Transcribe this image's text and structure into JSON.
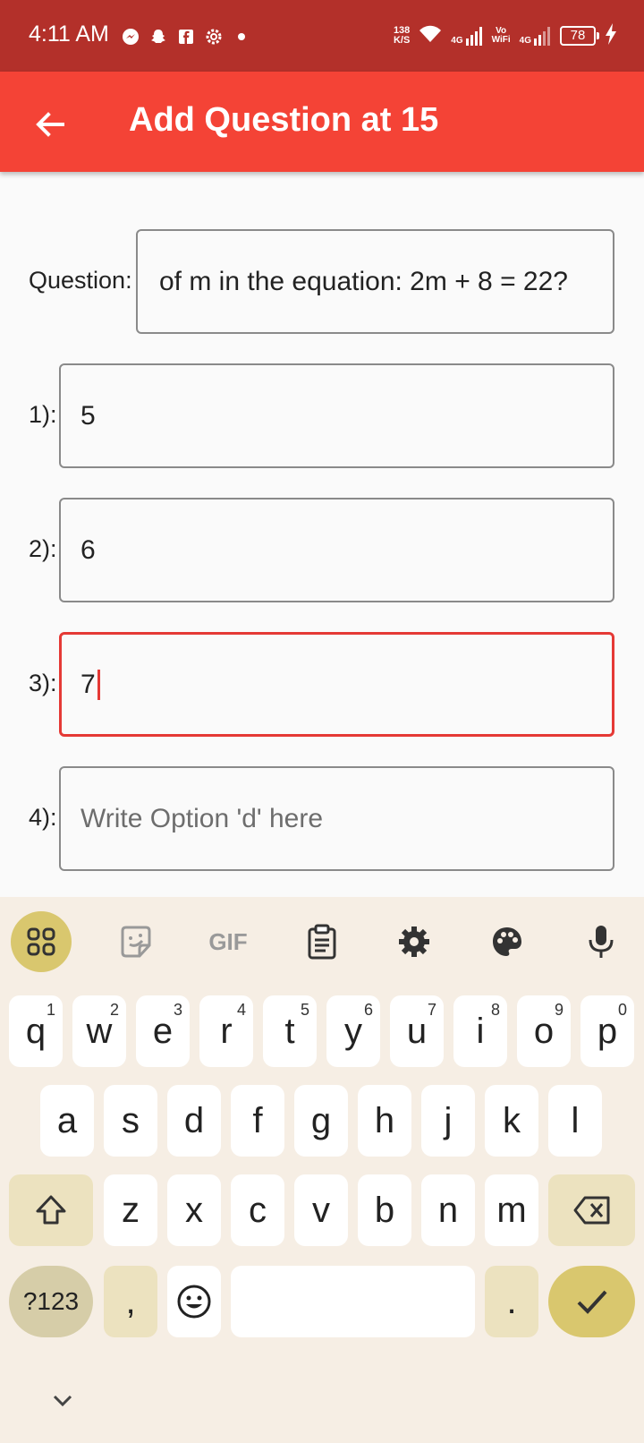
{
  "status_bar": {
    "time": "4:11 AM",
    "net_speed_value": "138",
    "net_speed_unit": "K/S",
    "net1": "4G",
    "vowifi_top": "Vo",
    "vowifi_bottom": "WiFi",
    "net2": "4G",
    "battery": "78"
  },
  "app_bar": {
    "title": "Add Question at 15"
  },
  "form": {
    "question_label": "Question:",
    "question_value": "of m in the equation: 2m + 8 = 22?",
    "options": [
      {
        "label": "1):",
        "value": "5",
        "placeholder": ""
      },
      {
        "label": "2):",
        "value": "6",
        "placeholder": ""
      },
      {
        "label": "3):",
        "value": "7",
        "placeholder": ""
      },
      {
        "label": "4):",
        "value": "",
        "placeholder": "Write Option 'd' here"
      }
    ]
  },
  "keyboard": {
    "toolbar": [
      "apps-icon",
      "sticker-icon",
      "GIF",
      "clipboard-icon",
      "settings-icon",
      "palette-icon",
      "mic-icon"
    ],
    "gif_label": "GIF",
    "row1": [
      "q",
      "w",
      "e",
      "r",
      "t",
      "y",
      "u",
      "i",
      "o",
      "p"
    ],
    "row1_hints": [
      "1",
      "2",
      "3",
      "4",
      "5",
      "6",
      "7",
      "8",
      "9",
      "0"
    ],
    "row2": [
      "a",
      "s",
      "d",
      "f",
      "g",
      "h",
      "j",
      "k",
      "l"
    ],
    "row3": [
      "z",
      "x",
      "c",
      "v",
      "b",
      "n",
      "m"
    ],
    "sym_label": "?123",
    "comma": ",",
    "period": ".",
    "accent_color": "#d9c76e"
  },
  "colors": {
    "status_bar": "#b3302a",
    "app_bar": "#f44336",
    "focus_border": "#e53935"
  }
}
